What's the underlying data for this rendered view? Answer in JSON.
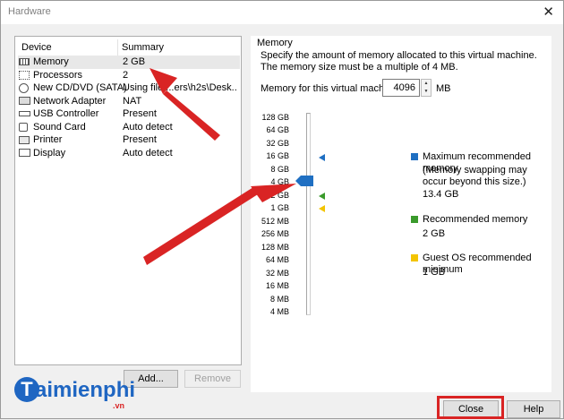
{
  "window": {
    "title": "Hardware"
  },
  "device_panel": {
    "header": {
      "device": "Device",
      "summary": "Summary"
    },
    "items": [
      {
        "label": "Memory",
        "summary": "2 GB",
        "icon": "memory-icon",
        "selected": true
      },
      {
        "label": "Processors",
        "summary": "2",
        "icon": "processor-icon"
      },
      {
        "label": "New CD/DVD (SATA)",
        "summary": "Using file ...ers\\h2s\\Desk...",
        "icon": "cd-dvd-icon"
      },
      {
        "label": "Network Adapter",
        "summary": "NAT",
        "icon": "network-adapter-icon"
      },
      {
        "label": "USB Controller",
        "summary": "Present",
        "icon": "usb-icon"
      },
      {
        "label": "Sound Card",
        "summary": "Auto detect",
        "icon": "sound-card-icon"
      },
      {
        "label": "Printer",
        "summary": "Present",
        "icon": "printer-icon"
      },
      {
        "label": "Display",
        "summary": "Auto detect",
        "icon": "display-icon"
      }
    ],
    "buttons": {
      "add": "Add...",
      "remove": "Remove"
    }
  },
  "memory_panel": {
    "legend": "Memory",
    "description": "Specify the amount of memory allocated to this virtual machine. The memory size must be a multiple of 4 MB.",
    "input_label": "Memory for this virtual machine:",
    "value": "4096",
    "unit": "MB",
    "scale": [
      "128 GB",
      "64 GB",
      "32 GB",
      "16 GB",
      "8 GB",
      "4 GB",
      "2 GB",
      "1 GB",
      "512 MB",
      "256 MB",
      "128 MB",
      "64 MB",
      "32 MB",
      "16 MB",
      "8 MB",
      "4 MB"
    ],
    "slider_value": "4 GB",
    "legend_items": [
      {
        "title": "Maximum recommended memory",
        "note": "(Memory swapping may occur beyond this size.)",
        "value": "13.4 GB",
        "color": "#1f6fc2"
      },
      {
        "title": "Recommended memory",
        "value": "2 GB",
        "color": "#3a9a2b"
      },
      {
        "title": "Guest OS recommended minimum",
        "value": "1 GB",
        "color": "#f3c400"
      }
    ]
  },
  "footer": {
    "close": "Close",
    "help": "Help"
  },
  "watermark": {
    "name": "aimienphi",
    "suffix": ".vn"
  },
  "colors": {
    "annotation": "#d92424",
    "accent": "#1f6fc2"
  }
}
